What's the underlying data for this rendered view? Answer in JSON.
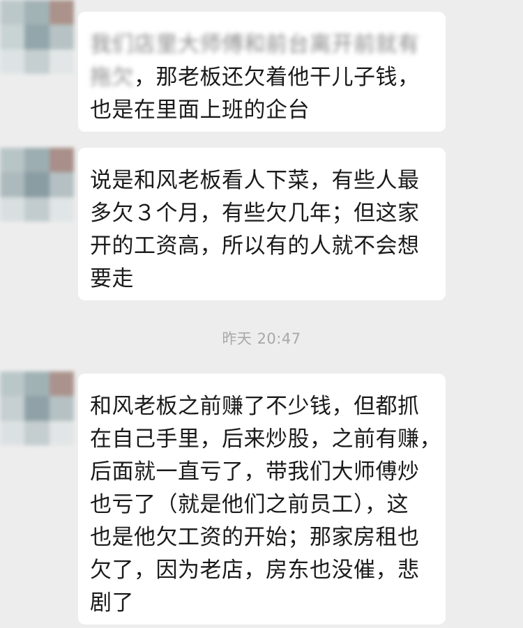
{
  "chat": {
    "timestamp": "昨天 20:47",
    "messages": [
      {
        "avatar_icon": "blurred-contact-avatar",
        "lines": [
          {
            "blurred": "我们店里大师傅和前台离开前就有",
            "text": ""
          },
          {
            "blurred": "拖欠",
            "text": "，那老板还欠着他干儿子钱，"
          },
          {
            "blurred": "",
            "text": "也是在里面上班的企台"
          }
        ]
      },
      {
        "avatar_icon": "blurred-contact-avatar",
        "lines": [
          {
            "blurred": "",
            "text": "说是和风老板看人下菜，有些人最"
          },
          {
            "blurred": "",
            "text": "多欠３个月，有些欠几年；但这家"
          },
          {
            "blurred": "",
            "text": "开的工资高，所以有的人就不会想"
          },
          {
            "blurred": "",
            "text": "要走"
          }
        ]
      },
      {
        "avatar_icon": "blurred-contact-avatar",
        "lines": [
          {
            "blurred": "",
            "text": "和风老板之前赚了不少钱，但都抓"
          },
          {
            "blurred": "",
            "text": "在自己手里，后来炒股，之前有赚，"
          },
          {
            "blurred": "",
            "text": "后面就一直亏了，带我们大师傅炒"
          },
          {
            "blurred": "",
            "text": "也亏了（就是他们之前员工），这"
          },
          {
            "blurred": "",
            "text": "也是他欠工资的开始；那家房租也"
          },
          {
            "blurred": "",
            "text": "欠了，因为老店，房东也没催，悲"
          },
          {
            "blurred": "",
            "text": "剧了"
          }
        ]
      }
    ]
  },
  "colors": {
    "background": "#ededed",
    "bubble": "#ffffff",
    "text": "#1a1a1a",
    "timestamp": "#a8a8a8"
  }
}
